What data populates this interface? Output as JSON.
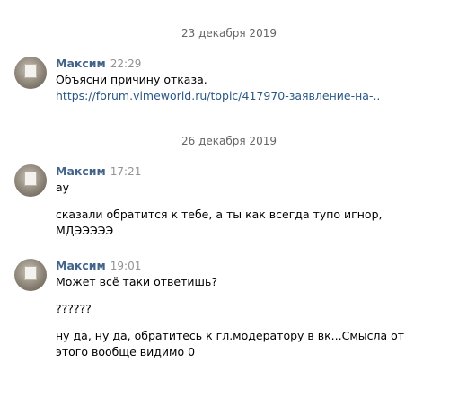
{
  "groups": [
    {
      "date": "23 декабря 2019",
      "messages": [
        {
          "author": "Максим",
          "time": "22:29",
          "lines": [
            "Объясни причину отказа."
          ],
          "link": "https://forum.vimeworld.ru/topic/417970-заявление-на-.."
        }
      ]
    },
    {
      "date": "26 декабря 2019",
      "messages": [
        {
          "author": "Максим",
          "time": "17:21",
          "lines": [
            "ау",
            "сказали обратится к тебе, а ты как всегда тупо игнор,",
            "МДЭЭЭЭЭ"
          ]
        },
        {
          "author": "Максим",
          "time": "19:01",
          "lines": [
            "Может всё таки ответишь?",
            "??????",
            "ну да, ну да, обратитесь к гл.модератору в вк...Смысла от",
            "этого вообще видимо 0"
          ]
        }
      ]
    }
  ]
}
